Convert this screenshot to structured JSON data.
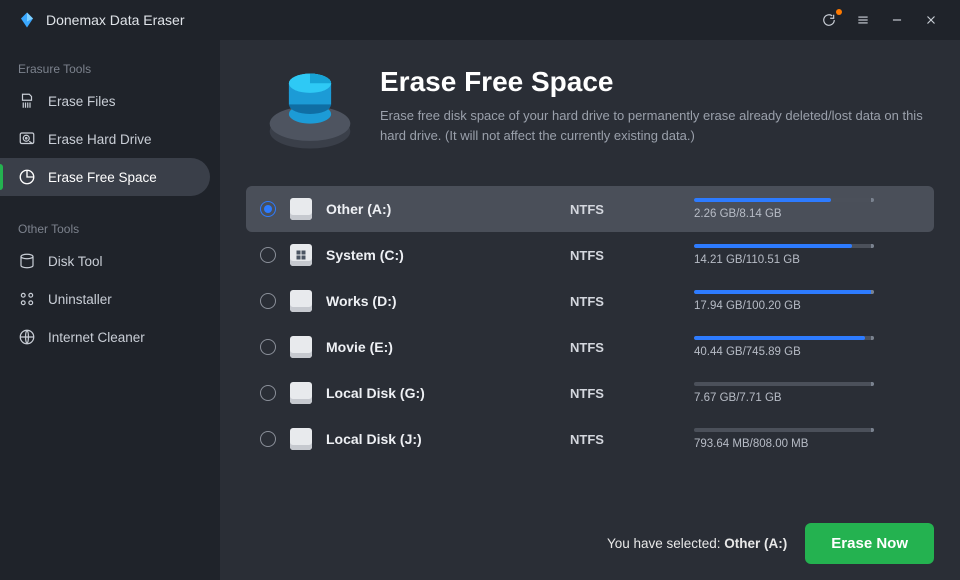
{
  "app": {
    "title": "Donemax Data Eraser"
  },
  "sidebar": {
    "section_erasure": "Erasure Tools",
    "section_other": "Other Tools",
    "items": {
      "erase_files": "Erase Files",
      "erase_hard_drive": "Erase Hard Drive",
      "erase_free_space": "Erase Free Space",
      "disk_tool": "Disk Tool",
      "uninstaller": "Uninstaller",
      "internet_cleaner": "Internet Cleaner"
    }
  },
  "hero": {
    "title": "Erase Free Space",
    "description": "Erase free disk space of your hard drive to permanently erase already deleted/lost data on this hard drive. (It will not affect the currently existing data.)"
  },
  "drives": [
    {
      "name": "Other (A:)",
      "fs": "NTFS",
      "usage": "2.26 GB/8.14 GB",
      "pct": 76,
      "selected": true,
      "system": false
    },
    {
      "name": "System (C:)",
      "fs": "NTFS",
      "usage": "14.21 GB/110.51 GB",
      "pct": 88,
      "selected": false,
      "system": true
    },
    {
      "name": "Works (D:)",
      "fs": "NTFS",
      "usage": "17.94 GB/100.20 GB",
      "pct": 100,
      "selected": false,
      "system": false
    },
    {
      "name": "Movie (E:)",
      "fs": "NTFS",
      "usage": "40.44 GB/745.89 GB",
      "pct": 95,
      "selected": false,
      "system": false
    },
    {
      "name": "Local Disk (G:)",
      "fs": "NTFS",
      "usage": "7.67 GB/7.71 GB",
      "pct": 0,
      "selected": false,
      "system": false
    },
    {
      "name": "Local Disk (J:)",
      "fs": "NTFS",
      "usage": "793.64 MB/808.00 MB",
      "pct": 0,
      "selected": false,
      "system": false
    }
  ],
  "footer": {
    "selected_prefix": "You have selected: ",
    "selected_value": "Other (A:)",
    "erase_label": "Erase Now"
  }
}
